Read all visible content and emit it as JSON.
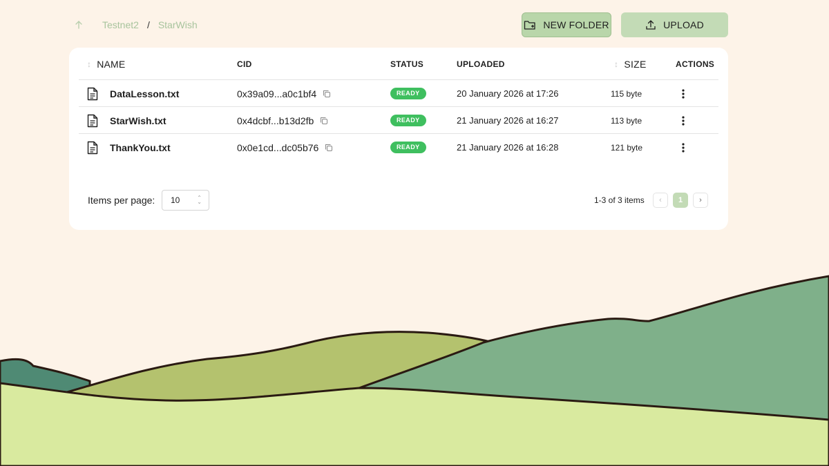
{
  "breadcrumb": {
    "items": [
      "Testnet2",
      "StarWish"
    ],
    "separator": "/"
  },
  "toolbar": {
    "new_folder_label": "NEW FOLDER",
    "upload_label": "UPLOAD"
  },
  "table": {
    "headers": {
      "name": "NAME",
      "cid": "CID",
      "status": "STATUS",
      "uploaded": "UPLOADED",
      "size": "SIZE",
      "actions": "ACTIONS"
    },
    "rows": [
      {
        "name": "DataLesson.txt",
        "cid": "0x39a09...a0c1bf4",
        "status": "READY",
        "uploaded": "20 January 2026 at 17:26",
        "size": "115 byte"
      },
      {
        "name": "StarWish.txt",
        "cid": "0x4dcbf...b13d2fb",
        "status": "READY",
        "uploaded": "21 January 2026 at 16:27",
        "size": "113 byte"
      },
      {
        "name": "ThankYou.txt",
        "cid": "0x0e1cd...dc05b76",
        "status": "READY",
        "uploaded": "21 January 2026 at 16:28",
        "size": "121 byte"
      }
    ]
  },
  "pagination": {
    "items_per_page_label": "Items per page:",
    "items_per_page_value": "10",
    "range_text": "1-3 of 3 items",
    "current_page": "1"
  },
  "colors": {
    "background": "#fdf3e8",
    "accent": "#c3dbb6",
    "status_ready": "#3fbf5f"
  },
  "icons": [
    "arrow-up-icon",
    "folder-plus-icon",
    "upload-icon",
    "sort-icon",
    "file-text-icon",
    "copy-icon",
    "more-vertical-icon",
    "chevron-left-icon",
    "chevron-right-icon",
    "select-arrows-icon"
  ]
}
